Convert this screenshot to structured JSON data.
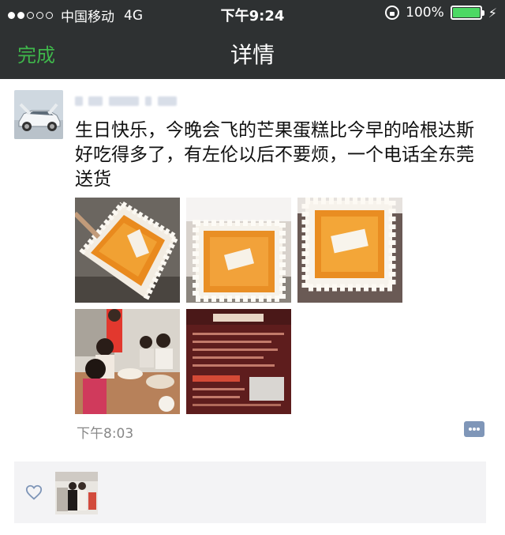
{
  "status_bar": {
    "carrier": "中国移动",
    "network": "4G",
    "time": "下午9:24",
    "battery": "100%"
  },
  "nav": {
    "done_label": "完成",
    "title": "详情"
  },
  "post": {
    "text": "生日快乐，今晚会飞的芒果蛋糕比今早的哈根达斯好吃得多了，有左伦以后不要烦，一个电话全东莞送货",
    "timestamp": "下午8:03",
    "photo_count": 5
  },
  "colors": {
    "accent": "#3fb64b",
    "nav_bg": "#2e3132",
    "battery": "#4cd964",
    "comment_button": "#7f96b8"
  }
}
